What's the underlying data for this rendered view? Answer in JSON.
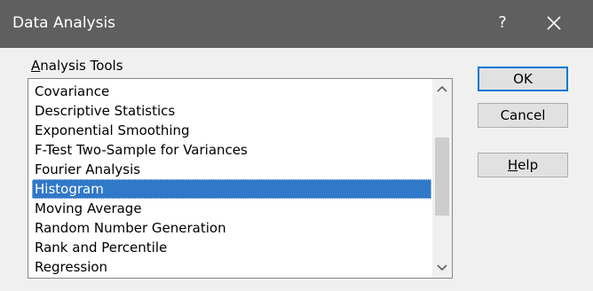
{
  "window": {
    "title": "Data Analysis",
    "help_glyph": "?"
  },
  "group": {
    "label_accel": "A",
    "label_rest": "nalysis Tools"
  },
  "list": {
    "items": [
      "Covariance",
      "Descriptive Statistics",
      "Exponential Smoothing",
      "F-Test Two-Sample for Variances",
      "Fourier Analysis",
      "Histogram",
      "Moving Average",
      "Random Number Generation",
      "Rank and Percentile",
      "Regression"
    ],
    "selected": "Histogram"
  },
  "buttons": {
    "ok": "OK",
    "cancel": "Cancel",
    "help_accel": "H",
    "help_rest": "elp"
  },
  "colors": {
    "titlebar": "#5f5f5f",
    "selection": "#3078c8",
    "default_button_border": "#0078d7"
  }
}
